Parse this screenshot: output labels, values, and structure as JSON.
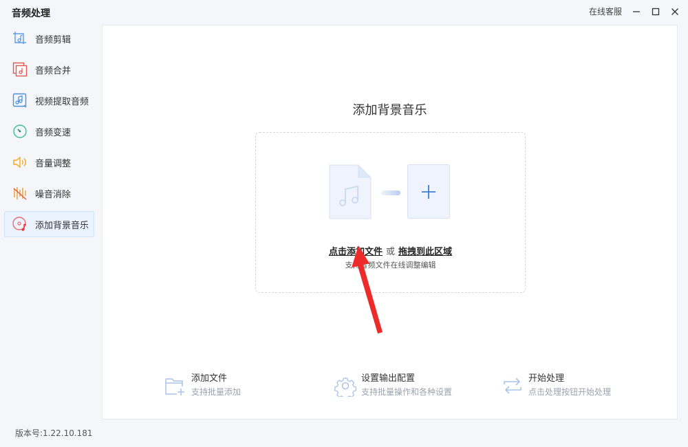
{
  "app": {
    "title": "音频处理",
    "support_label": "在线客服",
    "version_label": "版本号:1.22.10.181"
  },
  "sidebar": {
    "items": [
      {
        "label": "音频剪辑",
        "icon": "audio-cut-icon"
      },
      {
        "label": "音频合并",
        "icon": "audio-merge-icon"
      },
      {
        "label": "视频提取音频",
        "icon": "video-extract-audio-icon"
      },
      {
        "label": "音频变速",
        "icon": "audio-speed-icon"
      },
      {
        "label": "音量调整",
        "icon": "volume-icon"
      },
      {
        "label": "噪音消除",
        "icon": "noise-removal-icon"
      },
      {
        "label": "添加背景音乐",
        "icon": "background-music-icon",
        "active": true
      }
    ]
  },
  "main": {
    "title": "添加背景音乐",
    "dropzone": {
      "click_label": "点击添加文件",
      "or_label": "或",
      "drag_label": "拖拽到此区域",
      "hint": "支持音频文件在线调整编辑"
    },
    "steps": [
      {
        "title": "添加文件",
        "desc": "支持批量添加",
        "icon": "add-folder-icon"
      },
      {
        "title": "设置输出配置",
        "desc": "支持批量操作和各种设置",
        "icon": "gear-icon"
      },
      {
        "title": "开始处理",
        "desc": "点击处理按钮开始处理",
        "icon": "process-icon"
      }
    ]
  },
  "colors": {
    "accent": "#3d7bd9",
    "active_bg": "#eaf3ff",
    "arrow": "#ee2b2b"
  }
}
